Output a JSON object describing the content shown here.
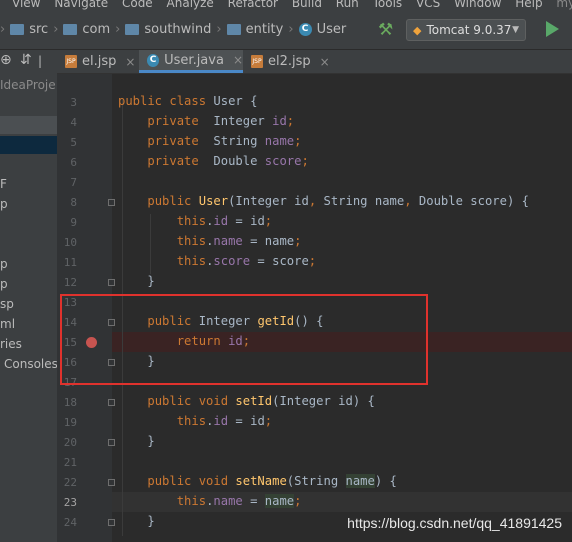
{
  "menu": {
    "items": [
      "View",
      "Navigate",
      "Code",
      "Analyze",
      "Refactor",
      "Build",
      "Run",
      "Tools",
      "VCS",
      "Window",
      "Help"
    ],
    "project_name": "myjsp"
  },
  "breadcrumb": {
    "items": [
      "src",
      "com",
      "southwind",
      "entity",
      "User"
    ]
  },
  "run_config": {
    "label": "Tomcat 9.0.37"
  },
  "project_panel": {
    "root_label": "IdeaProje",
    "items": [
      "F",
      "p",
      "p",
      "p",
      "sp",
      "ml",
      "ries",
      "Consoles"
    ]
  },
  "tabs": [
    {
      "label": "el.jsp",
      "close": "×"
    },
    {
      "label": "User.java",
      "close": "×"
    },
    {
      "label": "el2.jsp",
      "close": "×"
    }
  ],
  "editor": {
    "line_numbers": [
      3,
      4,
      5,
      6,
      7,
      8,
      9,
      10,
      11,
      12,
      13,
      14,
      15,
      16,
      17,
      18,
      19,
      20,
      21,
      22,
      23,
      24
    ],
    "current_line": 23,
    "breakpoint_line": 15
  },
  "watermark": "https://blog.csdn.net/qq_41891425"
}
